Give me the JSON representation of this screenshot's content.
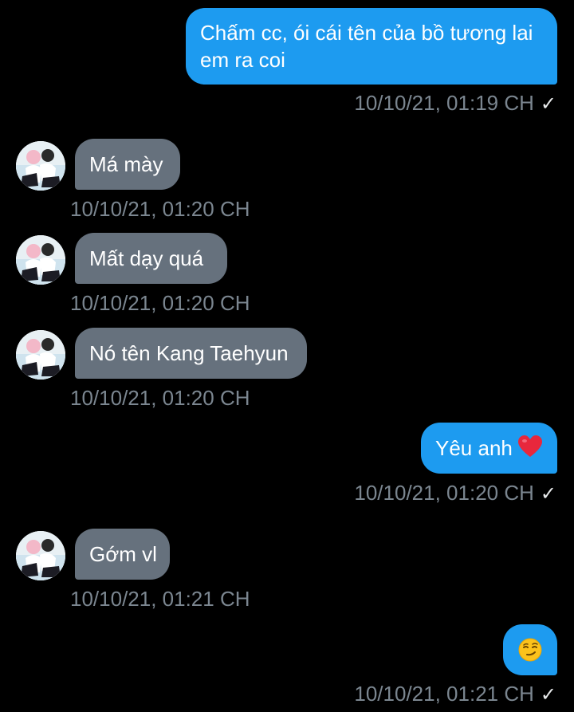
{
  "colors": {
    "background": "#000000",
    "outgoing_bubble": "#1d9bf0",
    "incoming_bubble": "#66717d",
    "timestamp": "#7b8690"
  },
  "messages": [
    {
      "direction": "outgoing",
      "lines": [
        "Chấm cc, ói cái tên của bồ tương lai",
        "em ra coi"
      ],
      "timestamp": "10/10/21, 01:19 CH",
      "status_icon": "check-icon"
    },
    {
      "direction": "incoming",
      "text": "Má mày",
      "timestamp": "10/10/21, 01:20 CH"
    },
    {
      "direction": "incoming",
      "text": "Mất dạy quá",
      "timestamp": "10/10/21, 01:20 CH"
    },
    {
      "direction": "incoming",
      "text": "Nó tên Kang Taehyun",
      "timestamp": "10/10/21, 01:20 CH"
    },
    {
      "direction": "outgoing",
      "text": "Yêu anh",
      "emoji": "red-heart-emoji",
      "timestamp": "10/10/21, 01:20 CH",
      "status_icon": "check-icon"
    },
    {
      "direction": "incoming",
      "text": "Gớm vl",
      "timestamp": "10/10/21, 01:21 CH"
    },
    {
      "direction": "outgoing",
      "emoji": "smirking-face-emoji",
      "timestamp": "10/10/21, 01:21 CH",
      "status_icon": "check-icon"
    }
  ]
}
